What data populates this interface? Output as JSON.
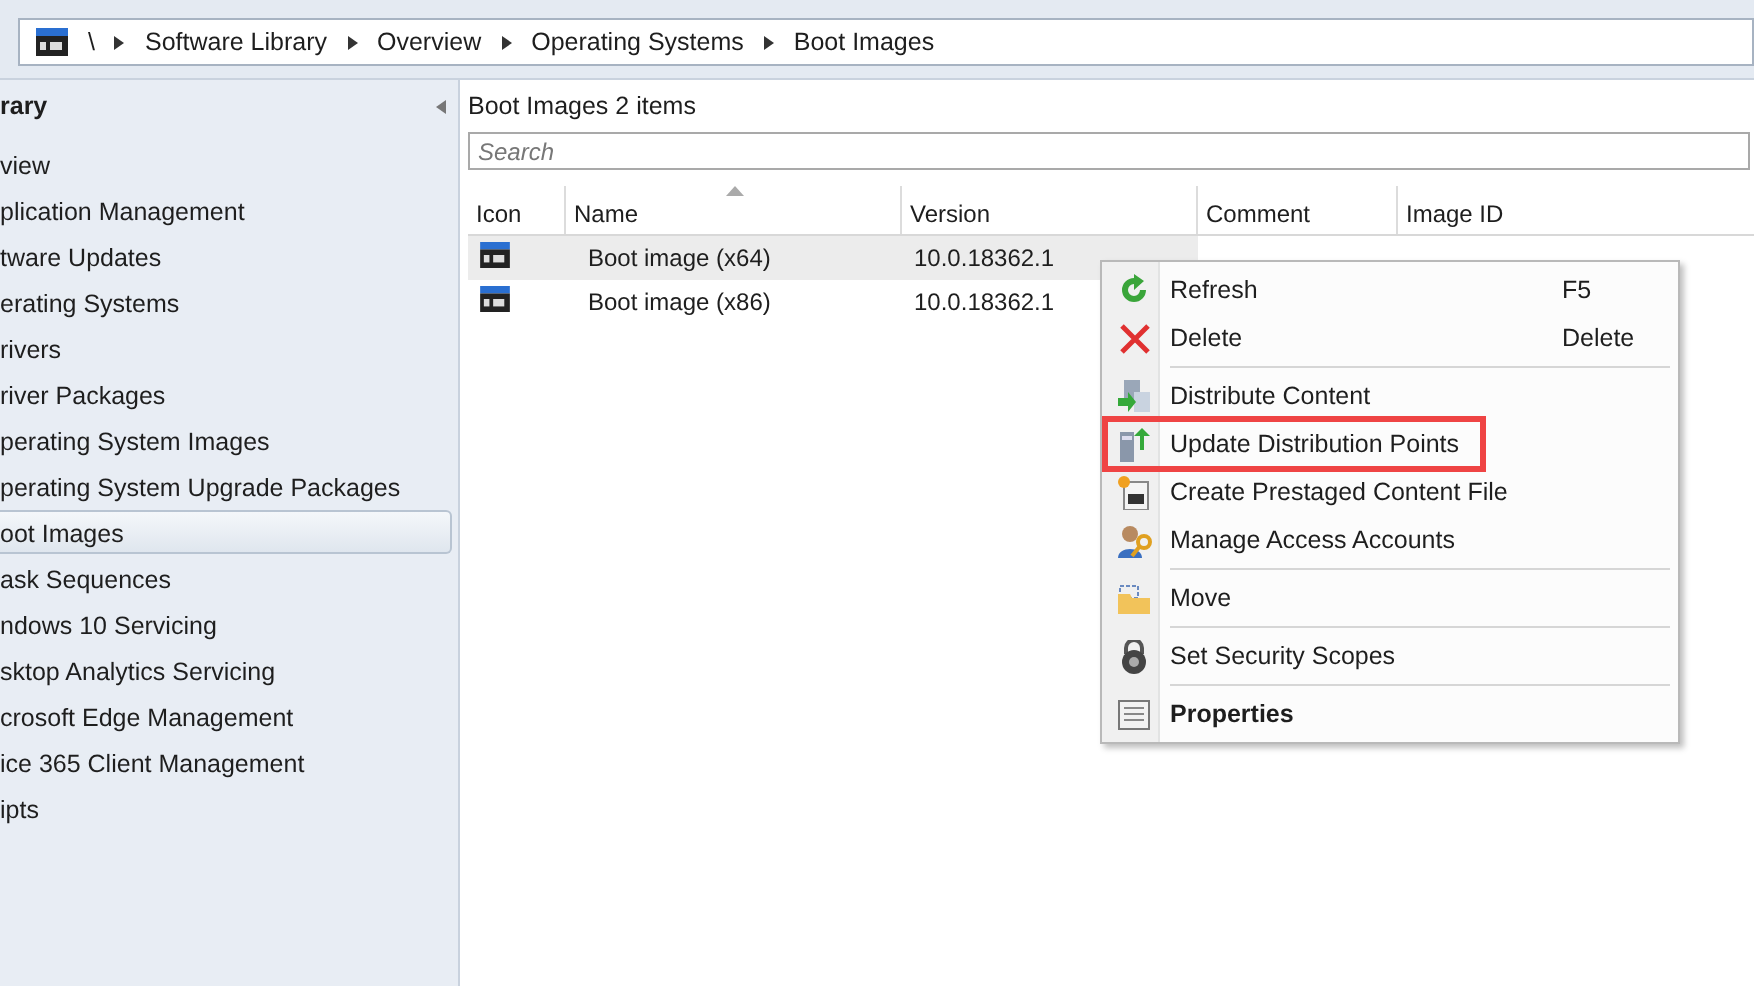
{
  "breadcrumb": [
    "\\",
    "Software Library",
    "Overview",
    "Operating Systems",
    "Boot Images"
  ],
  "sidebar": {
    "title": "rary",
    "items": [
      {
        "label": "view",
        "selected": false
      },
      {
        "label": "plication Management",
        "selected": false
      },
      {
        "label": "tware Updates",
        "selected": false
      },
      {
        "label": "erating Systems",
        "selected": false
      },
      {
        "label": "rivers",
        "selected": false
      },
      {
        "label": "river Packages",
        "selected": false
      },
      {
        "label": "perating System Images",
        "selected": false
      },
      {
        "label": "perating System Upgrade Packages",
        "selected": false
      },
      {
        "label": "oot Images",
        "selected": true
      },
      {
        "label": "ask Sequences",
        "selected": false
      },
      {
        "label": "ndows 10 Servicing",
        "selected": false
      },
      {
        "label": "sktop Analytics Servicing",
        "selected": false
      },
      {
        "label": "crosoft Edge Management",
        "selected": false
      },
      {
        "label": "ice 365 Client Management",
        "selected": false
      },
      {
        "label": "ipts",
        "selected": false
      }
    ]
  },
  "main": {
    "title": "Boot Images 2 items",
    "search": {
      "placeholder": "Search"
    }
  },
  "table": {
    "columns": [
      "Icon",
      "Name",
      "Version",
      "Comment",
      "Image ID"
    ],
    "rows": [
      {
        "name": "Boot image (x64)",
        "version": "10.0.18362.1",
        "selected": true
      },
      {
        "name": "Boot image (x86)",
        "version": "10.0.18362.1",
        "selected": false
      }
    ]
  },
  "context_menu": {
    "items": [
      {
        "kind": "item",
        "label": "Refresh",
        "shortcut": "F5",
        "bold": false,
        "highlighted": false
      },
      {
        "kind": "item",
        "label": "Delete",
        "shortcut": "Delete",
        "bold": false,
        "highlighted": false
      },
      {
        "kind": "separator"
      },
      {
        "kind": "item",
        "label": "Distribute Content",
        "bold": false,
        "highlighted": false
      },
      {
        "kind": "item",
        "label": "Update Distribution Points",
        "bold": false,
        "highlighted": true
      },
      {
        "kind": "item",
        "label": "Create Prestaged Content File",
        "bold": false,
        "highlighted": false
      },
      {
        "kind": "item",
        "label": "Manage Access Accounts",
        "bold": false,
        "highlighted": false
      },
      {
        "kind": "separator"
      },
      {
        "kind": "item",
        "label": "Move",
        "bold": false,
        "highlighted": false
      },
      {
        "kind": "separator"
      },
      {
        "kind": "item",
        "label": "Set Security Scopes",
        "bold": false,
        "highlighted": false
      },
      {
        "kind": "separator"
      },
      {
        "kind": "item",
        "label": "Properties",
        "bold": true,
        "highlighted": false
      }
    ]
  }
}
